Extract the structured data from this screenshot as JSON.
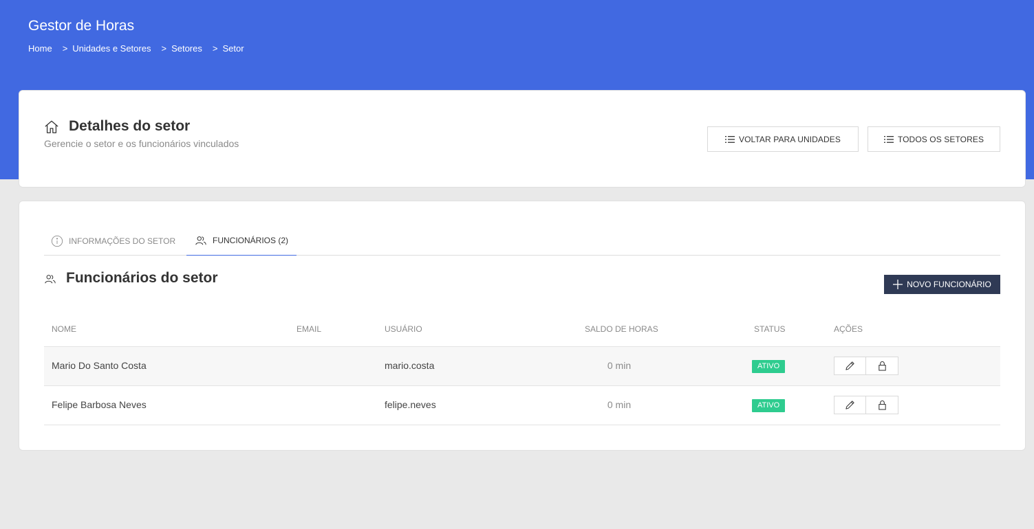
{
  "header": {
    "app_title": "Gestor de Horas",
    "breadcrumb": [
      "Home",
      "Unidades e Setores",
      "Setores",
      "Setor"
    ],
    "separator": ">"
  },
  "details": {
    "icon": "home-icon",
    "title": "Detalhes do setor",
    "subtitle": "Gerencie o setor e os funcionários vinculados",
    "buttons": {
      "voltar": "VOLTAR PARA UNIDADES",
      "todos": "TODOS OS SETORES"
    }
  },
  "tabs": [
    {
      "label": "INFORMAÇÕES DO SETOR",
      "icon": "info-icon",
      "active": false
    },
    {
      "label": "FUNCIONÁRIOS (2)",
      "icon": "users-icon",
      "active": true
    }
  ],
  "section": {
    "icon": "users-icon",
    "title": "Funcionários do setor",
    "new_button": "NOVO FUNCIONÁRIO"
  },
  "table": {
    "columns": [
      "NOME",
      "EMAIL",
      "USUÁRIO",
      "SALDO DE HORAS",
      "STATUS",
      "AÇÕES"
    ],
    "rows": [
      {
        "nome": "Mario Do Santo Costa",
        "email": "",
        "usuario": "mario.costa",
        "saldo": "0 min",
        "status": "ATIVO"
      },
      {
        "nome": "Felipe Barbosa Neves",
        "email": "",
        "usuario": "felipe.neves",
        "saldo": "0 min",
        "status": "ATIVO"
      }
    ]
  },
  "colors": {
    "primary": "#4169e1",
    "dark_button": "#2f3a55",
    "status_active": "#2ecc8f",
    "background": "#e9e9e9"
  }
}
